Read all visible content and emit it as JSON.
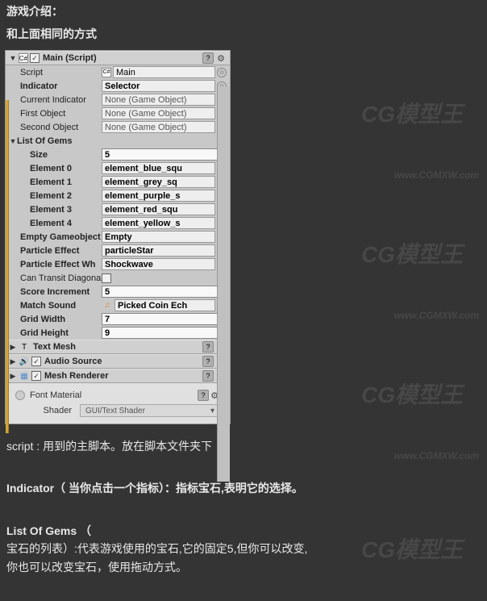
{
  "intro": {
    "line1": "游戏介绍：",
    "line2": "和上面相同的方式"
  },
  "components": {
    "main": {
      "title": "Main (Script)",
      "script_label": "Script",
      "script_value": "Main",
      "indicator_label": "Indicator",
      "indicator_value": "Selector",
      "cur_ind_label": "Current Indicator",
      "cur_ind_value": "None (Game Object)",
      "first_label": "First Object",
      "first_value": "None (Game Object)",
      "second_label": "Second Object",
      "second_value": "None (Game Object)",
      "list_label": "List Of Gems",
      "size_label": "Size",
      "size_value": "5",
      "el0_label": "Element 0",
      "el0_value": "element_blue_squ",
      "el1_label": "Element 1",
      "el1_value": "element_grey_sq",
      "el2_label": "Element 2",
      "el2_value": "element_purple_s",
      "el3_label": "Element 3",
      "el3_value": "element_red_squ",
      "el4_label": "Element 4",
      "el4_value": "element_yellow_s",
      "empty_label": "Empty Gameobject",
      "empty_value": "Empty",
      "pe_label": "Particle Effect",
      "pe_value": "particleStar",
      "pew_label": "Particle Effect Wh",
      "pew_value": "Shockwave",
      "diag_label": "Can Transit Diagonal",
      "score_label": "Score Increment",
      "score_value": "5",
      "sound_label": "Match Sound",
      "sound_value": "Picked Coin Ech",
      "gw_label": "Grid Width",
      "gw_value": "7",
      "gh_label": "Grid Height",
      "gh_value": "9"
    },
    "textmesh": {
      "title": "Text Mesh"
    },
    "audio": {
      "title": "Audio Source"
    },
    "mesh": {
      "title": "Mesh Renderer"
    },
    "material": {
      "name": "Font Material",
      "shader_label": "Shader",
      "shader_value": "GUI/Text Shader"
    }
  },
  "descriptions": {
    "script": "script : 用到的主脚本。放在脚本文件夹下",
    "indicator": "Indicator（  当你点击一个指标）：指标宝石,表明它的选择。",
    "list_title": "List Of Gems （",
    "list_line1": "宝石的列表）:代表游戏使用的宝石,它的固定5,但你可以改变,",
    "list_line2": "  你也可以改变宝石，使用拖动方式。"
  },
  "watermarks": [
    "CG模型王",
    "www.CGMXW.com"
  ]
}
